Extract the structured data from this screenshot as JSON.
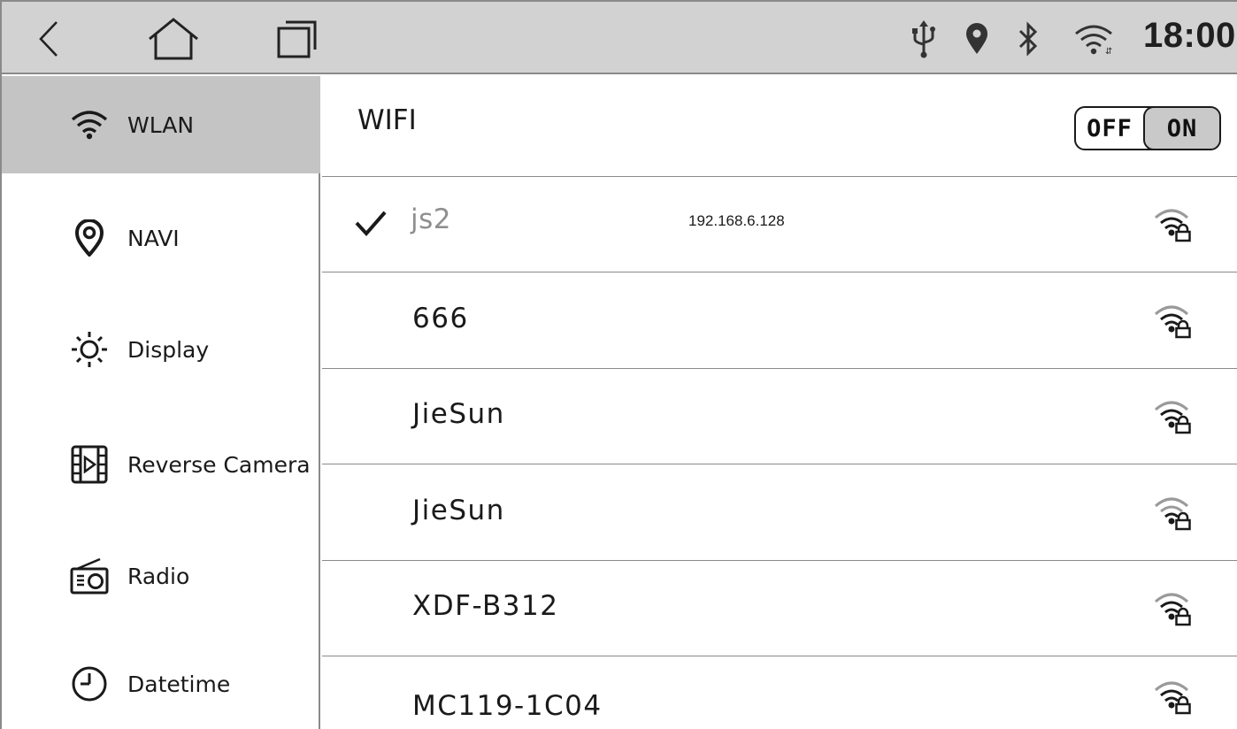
{
  "statusbar": {
    "time": "18:00",
    "icons": [
      "usb-icon",
      "location-icon",
      "bluetooth-icon",
      "wifi-status-icon"
    ],
    "nav_buttons": [
      "back-icon",
      "home-icon",
      "recent-apps-icon"
    ]
  },
  "sidebar": {
    "items": [
      {
        "label": "WLAN",
        "icon": "wifi-icon",
        "active": true
      },
      {
        "label": "NAVI",
        "icon": "location-pin-icon",
        "active": false
      },
      {
        "label": "Display",
        "icon": "brightness-icon",
        "active": false
      },
      {
        "label": "Reverse Camera",
        "icon": "film-play-icon",
        "active": false
      },
      {
        "label": "Radio",
        "icon": "radio-icon",
        "active": false
      },
      {
        "label": "Datetime",
        "icon": "clock-icon",
        "active": false
      }
    ]
  },
  "wifi": {
    "title": "WIFI",
    "toggle": {
      "off_label": "OFF",
      "on_label": "ON",
      "state": "ON"
    },
    "networks": [
      {
        "name": "js2",
        "ip": "192.168.6.128",
        "connected": true,
        "icon": "wifi-locked-icon"
      },
      {
        "name": "666",
        "ip": "",
        "connected": false,
        "icon": "wifi-locked-icon"
      },
      {
        "name": "JieSun",
        "ip": "",
        "connected": false,
        "icon": "wifi-locked-icon"
      },
      {
        "name": "JieSun",
        "ip": "",
        "connected": false,
        "icon": "wifi-locked-icon"
      },
      {
        "name": "XDF-B312",
        "ip": "",
        "connected": false,
        "icon": "wifi-locked-icon"
      },
      {
        "name": "MC119-1C04",
        "ip": "",
        "connected": false,
        "icon": "wifi-locked-icon"
      }
    ]
  },
  "colors": {
    "statusbar_bg": "#d2d2d2",
    "active_item_bg": "#c4c4c4",
    "divider": "#8a8a8a",
    "connected_text": "#8f8f8f"
  }
}
